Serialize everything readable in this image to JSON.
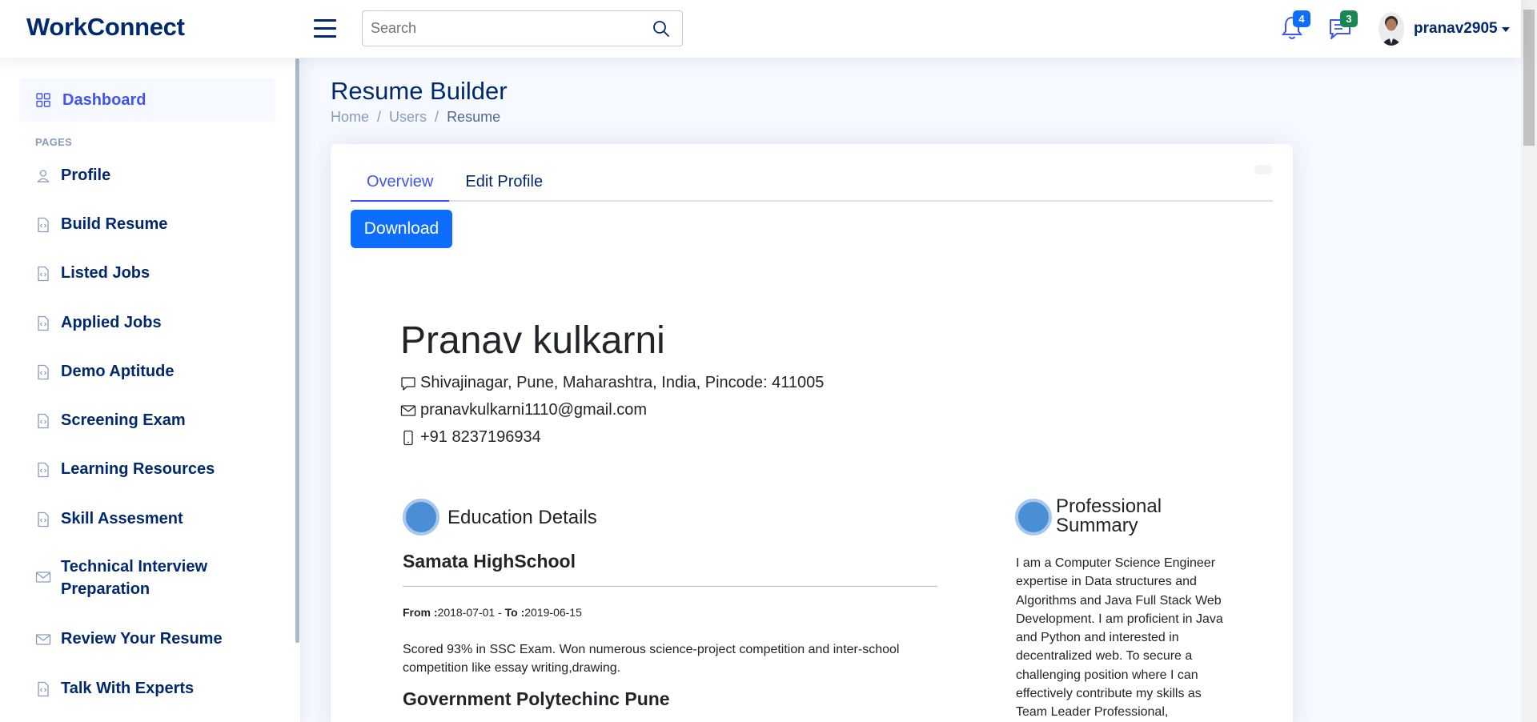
{
  "header": {
    "logo": "WorkConnect",
    "search_placeholder": "Search",
    "notifications_count": "4",
    "messages_count": "3",
    "username": "pranav2905"
  },
  "sidebar": {
    "dashboard_label": "Dashboard",
    "pages_heading": "PAGES",
    "items": [
      {
        "label": "Profile",
        "icon": "person-icon"
      },
      {
        "label": "Build Resume",
        "icon": "file-code-icon"
      },
      {
        "label": "Listed Jobs",
        "icon": "file-code-icon"
      },
      {
        "label": "Applied Jobs",
        "icon": "file-code-icon"
      },
      {
        "label": "Demo Aptitude",
        "icon": "file-code-icon"
      },
      {
        "label": "Screening Exam",
        "icon": "file-code-icon"
      },
      {
        "label": "Learning Resources",
        "icon": "file-code-icon"
      },
      {
        "label": "Skill Assesment",
        "icon": "file-code-icon"
      },
      {
        "label": "Technical Interview Preparation",
        "icon": "envelope-icon"
      },
      {
        "label": "Review Your Resume",
        "icon": "envelope-icon"
      },
      {
        "label": "Talk With Experts",
        "icon": "file-code-icon"
      }
    ]
  },
  "main": {
    "page_title": "Resume Builder",
    "breadcrumb": [
      "Home",
      "Users",
      "Resume"
    ],
    "tabs": [
      "Overview",
      "Edit Profile"
    ],
    "download_label": "Download"
  },
  "resume": {
    "name": "Pranav kulkarni",
    "address": "Shivajinagar, Pune, Maharashtra, India, Pincode: 411005",
    "email": "pranavkulkarni1110@gmail.com",
    "phone": "+91 8237196934",
    "education_title": "Education Details",
    "education": [
      {
        "school": "Samata HighSchool",
        "from_label": "From :",
        "from": "2018-07-01",
        "to_label": "To :",
        "to": "2019-06-15",
        "description": "Scored 93% in SSC Exam. Won numerous science-project competition and inter-school competition like essay writing,drawing."
      },
      {
        "school": "Government Polytechinc Pune"
      }
    ],
    "summary_title_line1": "Professional",
    "summary_title_line2": "Summary",
    "summary": "I am a Computer Science Engineer expertise in Data structures and Algorithms and Java Full Stack Web Development. I am proficient in Java and Python and interested in decentralized web. To secure a challenging position where I can effectively contribute my skills as Team Leader Professional,"
  },
  "colors": {
    "brand": "#012970",
    "accent": "#4154f1",
    "button": "#0d6efd",
    "notif_badge": "#0d6efd",
    "msg_badge": "#198754",
    "section_dot": "#4a8fd4"
  }
}
